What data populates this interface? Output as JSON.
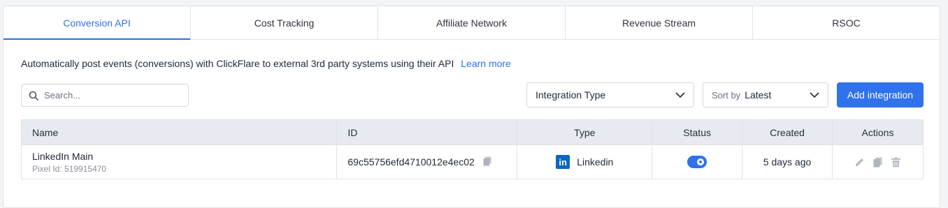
{
  "tabs": [
    {
      "label": "Conversion API",
      "active": true
    },
    {
      "label": "Cost Tracking",
      "active": false
    },
    {
      "label": "Affiliate Network",
      "active": false
    },
    {
      "label": "Revenue Stream",
      "active": false
    },
    {
      "label": "RSOC",
      "active": false
    }
  ],
  "description": {
    "text": "Automatically post events (conversions) with ClickFlare to external 3rd party systems using their API",
    "link_label": "Learn more"
  },
  "search": {
    "placeholder": "Search...",
    "value": "",
    "icon": "search-icon"
  },
  "filters": {
    "integration_type": {
      "value": "Integration Type"
    },
    "sort": {
      "prefix": "Sort by",
      "value": "Latest"
    }
  },
  "add_button_label": "Add integration",
  "table": {
    "columns": [
      "Name",
      "ID",
      "Type",
      "Status",
      "Created",
      "Actions"
    ],
    "rows": [
      {
        "name": "LinkedIn Main",
        "pixel": "Pixel Id: 519915470",
        "id": "69c55756efd4710012e4ec02",
        "type": "Linkedin",
        "type_icon": "linkedin-icon",
        "status_enabled": true,
        "created": "5 days ago",
        "actions": [
          "edit-icon",
          "copy-icon",
          "trash-icon"
        ]
      }
    ]
  },
  "colors": {
    "accent": "#3071ec",
    "linkedin": "#0a66c2",
    "header_bg": "#e7eaf0"
  }
}
